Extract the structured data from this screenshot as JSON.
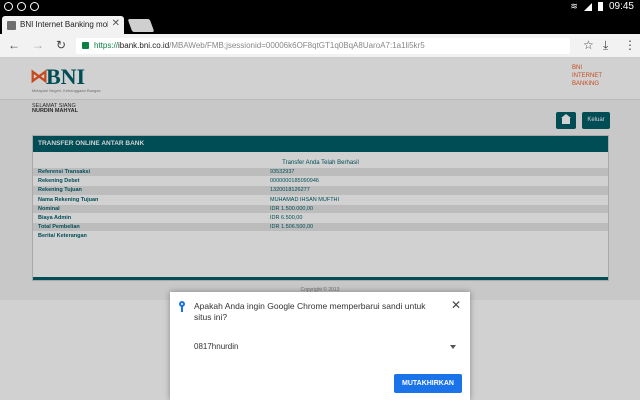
{
  "statusbar": {
    "time": "09:45"
  },
  "browser": {
    "tab_title": "BNI Internet Banking mobile",
    "tab_close": "✕",
    "url_scheme": "https://",
    "url_host": "ibank.bni.co.id",
    "url_path": "/MBAWeb/FMB;jsessionid=00006k6OF8qtGT1q0BqA8UaroA7:1a1li5kr5"
  },
  "bank": {
    "logo_text": "BNI",
    "logo_tagline": "Melayani Negeri, Kebanggaan Bangsa",
    "brand_lines": [
      "BNI",
      "INTERNET",
      "BANKING"
    ]
  },
  "user": {
    "greeting": "SELAMAT SIANG",
    "name": "NURDIN MAHYAL"
  },
  "buttons": {
    "logout": "Keluar"
  },
  "transfer": {
    "heading": "TRANSFER ONLINE ANTAR BANK",
    "status": "Transfer Anda Telah Berhasil",
    "rows": [
      {
        "label": "Referensi Transaksi",
        "value": "93532937"
      },
      {
        "label": "Rekening Debet",
        "value": "0000000185090946"
      },
      {
        "label": "Rekening Tujuan",
        "value": "1320018126277"
      },
      {
        "label": "Nama Rekening Tujuan",
        "value": "MUHAMAD IHSAN MUFTHI"
      },
      {
        "label": "Nominal",
        "value": "IDR 1.500.000,00"
      },
      {
        "label": "Biaya Admin",
        "value": "IDR 6.500,00"
      },
      {
        "label": "Total Pembelian",
        "value": "IDR 1.506.500,00"
      },
      {
        "label": "Berita/ Keterangan",
        "value": ""
      }
    ]
  },
  "footer": {
    "copyright": "Copyright © 2013"
  },
  "dialog": {
    "question": "Apakah Anda ingin Google Chrome memperbarui sandi untuk situs ini?",
    "account": "0817hnurdin",
    "update_button": "MUTAKHIRKAN",
    "close": "✕"
  },
  "colors": {
    "bni_teal": "#005e6a",
    "bni_orange": "#f15a23",
    "chrome_blue": "#1a73e8"
  }
}
